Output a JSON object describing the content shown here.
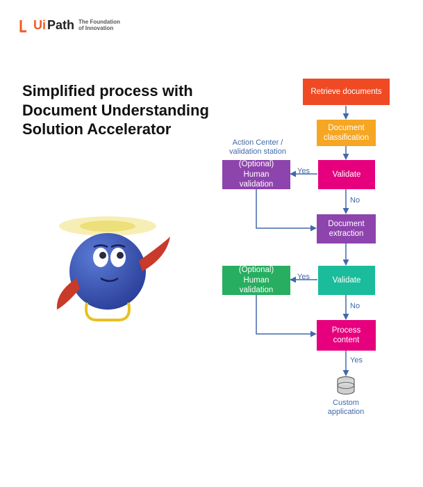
{
  "logo": {
    "brand_ui": "Ui",
    "brand_path": "Path",
    "tagline_l1": "The Foundation",
    "tagline_l2": "of Innovation"
  },
  "title": "Simplified process with Document Understanding Solution Accelerator",
  "flow": {
    "retrieve": "Retrieve documents",
    "classification": "Document classification",
    "validate1": "Validate",
    "human1": "(Optional)\nHuman validation",
    "action_center": "Action Center /\nvalidation station",
    "extraction": "Document extraction",
    "validate2": "Validate",
    "human2": "(Optional)\nHuman validation",
    "process": "Process content",
    "custom_app": "Custom application"
  },
  "labels": {
    "yes": "Yes",
    "no": "No"
  },
  "colors": {
    "orange_red": "#f04a24",
    "amber": "#f6a623",
    "magenta": "#e6007e",
    "purple": "#8e44ad",
    "teal": "#1abc9c",
    "green": "#27ae60",
    "connector": "#4169a8"
  }
}
